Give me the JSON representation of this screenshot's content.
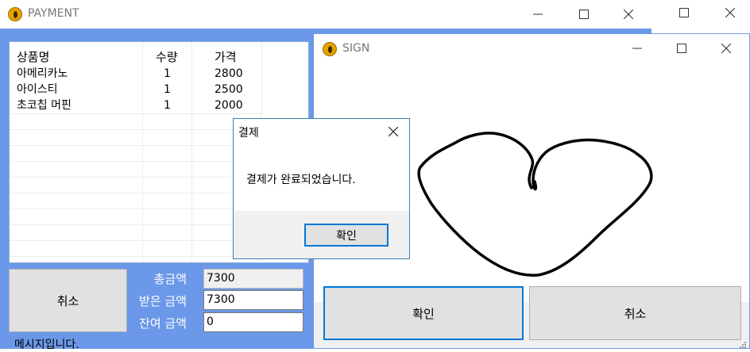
{
  "background_window": {
    "controls": [
      "maximize",
      "close"
    ]
  },
  "payment_window": {
    "title": "PAYMENT",
    "table": {
      "columns": [
        "상품명",
        "수량",
        "가격"
      ],
      "rows": [
        [
          "아메리카노",
          "1",
          "2800"
        ],
        [
          "아이스티",
          "1",
          "2500"
        ],
        [
          "초코칩 머핀",
          "1",
          "2000"
        ]
      ]
    },
    "cancel_label": "취소",
    "total_label": "총금액",
    "total_value": "7300",
    "received_label": "받은 금액",
    "received_value": "7300",
    "change_label": "잔여 금액",
    "change_value": "0",
    "status_text": "메시지입니다."
  },
  "sign_window": {
    "title": "SIGN",
    "confirm_label": "확인",
    "cancel_label": "취소"
  },
  "message_box": {
    "title": "결제",
    "message": "결제가 완료되었습니다.",
    "ok_label": "확인"
  },
  "colors": {
    "payment_bg": "#6b98e8",
    "focus_blue": "#0078d7",
    "app_icon": "#e8a100"
  }
}
